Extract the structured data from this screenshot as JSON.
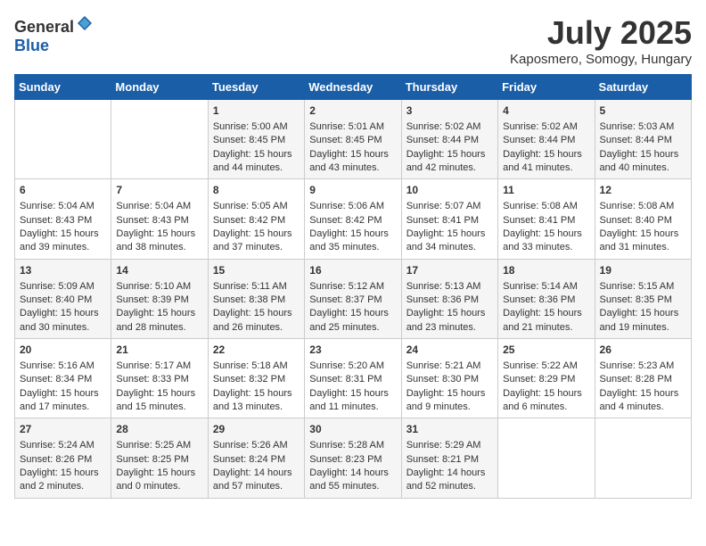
{
  "header": {
    "logo_general": "General",
    "logo_blue": "Blue",
    "month_title": "July 2025",
    "subtitle": "Kaposmero, Somogy, Hungary"
  },
  "weekdays": [
    "Sunday",
    "Monday",
    "Tuesday",
    "Wednesday",
    "Thursday",
    "Friday",
    "Saturday"
  ],
  "weeks": [
    [
      {
        "day": "",
        "sunrise": "",
        "sunset": "",
        "daylight": ""
      },
      {
        "day": "",
        "sunrise": "",
        "sunset": "",
        "daylight": ""
      },
      {
        "day": "1",
        "sunrise": "Sunrise: 5:00 AM",
        "sunset": "Sunset: 8:45 PM",
        "daylight": "Daylight: 15 hours and 44 minutes."
      },
      {
        "day": "2",
        "sunrise": "Sunrise: 5:01 AM",
        "sunset": "Sunset: 8:45 PM",
        "daylight": "Daylight: 15 hours and 43 minutes."
      },
      {
        "day": "3",
        "sunrise": "Sunrise: 5:02 AM",
        "sunset": "Sunset: 8:44 PM",
        "daylight": "Daylight: 15 hours and 42 minutes."
      },
      {
        "day": "4",
        "sunrise": "Sunrise: 5:02 AM",
        "sunset": "Sunset: 8:44 PM",
        "daylight": "Daylight: 15 hours and 41 minutes."
      },
      {
        "day": "5",
        "sunrise": "Sunrise: 5:03 AM",
        "sunset": "Sunset: 8:44 PM",
        "daylight": "Daylight: 15 hours and 40 minutes."
      }
    ],
    [
      {
        "day": "6",
        "sunrise": "Sunrise: 5:04 AM",
        "sunset": "Sunset: 8:43 PM",
        "daylight": "Daylight: 15 hours and 39 minutes."
      },
      {
        "day": "7",
        "sunrise": "Sunrise: 5:04 AM",
        "sunset": "Sunset: 8:43 PM",
        "daylight": "Daylight: 15 hours and 38 minutes."
      },
      {
        "day": "8",
        "sunrise": "Sunrise: 5:05 AM",
        "sunset": "Sunset: 8:42 PM",
        "daylight": "Daylight: 15 hours and 37 minutes."
      },
      {
        "day": "9",
        "sunrise": "Sunrise: 5:06 AM",
        "sunset": "Sunset: 8:42 PM",
        "daylight": "Daylight: 15 hours and 35 minutes."
      },
      {
        "day": "10",
        "sunrise": "Sunrise: 5:07 AM",
        "sunset": "Sunset: 8:41 PM",
        "daylight": "Daylight: 15 hours and 34 minutes."
      },
      {
        "day": "11",
        "sunrise": "Sunrise: 5:08 AM",
        "sunset": "Sunset: 8:41 PM",
        "daylight": "Daylight: 15 hours and 33 minutes."
      },
      {
        "day": "12",
        "sunrise": "Sunrise: 5:08 AM",
        "sunset": "Sunset: 8:40 PM",
        "daylight": "Daylight: 15 hours and 31 minutes."
      }
    ],
    [
      {
        "day": "13",
        "sunrise": "Sunrise: 5:09 AM",
        "sunset": "Sunset: 8:40 PM",
        "daylight": "Daylight: 15 hours and 30 minutes."
      },
      {
        "day": "14",
        "sunrise": "Sunrise: 5:10 AM",
        "sunset": "Sunset: 8:39 PM",
        "daylight": "Daylight: 15 hours and 28 minutes."
      },
      {
        "day": "15",
        "sunrise": "Sunrise: 5:11 AM",
        "sunset": "Sunset: 8:38 PM",
        "daylight": "Daylight: 15 hours and 26 minutes."
      },
      {
        "day": "16",
        "sunrise": "Sunrise: 5:12 AM",
        "sunset": "Sunset: 8:37 PM",
        "daylight": "Daylight: 15 hours and 25 minutes."
      },
      {
        "day": "17",
        "sunrise": "Sunrise: 5:13 AM",
        "sunset": "Sunset: 8:36 PM",
        "daylight": "Daylight: 15 hours and 23 minutes."
      },
      {
        "day": "18",
        "sunrise": "Sunrise: 5:14 AM",
        "sunset": "Sunset: 8:36 PM",
        "daylight": "Daylight: 15 hours and 21 minutes."
      },
      {
        "day": "19",
        "sunrise": "Sunrise: 5:15 AM",
        "sunset": "Sunset: 8:35 PM",
        "daylight": "Daylight: 15 hours and 19 minutes."
      }
    ],
    [
      {
        "day": "20",
        "sunrise": "Sunrise: 5:16 AM",
        "sunset": "Sunset: 8:34 PM",
        "daylight": "Daylight: 15 hours and 17 minutes."
      },
      {
        "day": "21",
        "sunrise": "Sunrise: 5:17 AM",
        "sunset": "Sunset: 8:33 PM",
        "daylight": "Daylight: 15 hours and 15 minutes."
      },
      {
        "day": "22",
        "sunrise": "Sunrise: 5:18 AM",
        "sunset": "Sunset: 8:32 PM",
        "daylight": "Daylight: 15 hours and 13 minutes."
      },
      {
        "day": "23",
        "sunrise": "Sunrise: 5:20 AM",
        "sunset": "Sunset: 8:31 PM",
        "daylight": "Daylight: 15 hours and 11 minutes."
      },
      {
        "day": "24",
        "sunrise": "Sunrise: 5:21 AM",
        "sunset": "Sunset: 8:30 PM",
        "daylight": "Daylight: 15 hours and 9 minutes."
      },
      {
        "day": "25",
        "sunrise": "Sunrise: 5:22 AM",
        "sunset": "Sunset: 8:29 PM",
        "daylight": "Daylight: 15 hours and 6 minutes."
      },
      {
        "day": "26",
        "sunrise": "Sunrise: 5:23 AM",
        "sunset": "Sunset: 8:28 PM",
        "daylight": "Daylight: 15 hours and 4 minutes."
      }
    ],
    [
      {
        "day": "27",
        "sunrise": "Sunrise: 5:24 AM",
        "sunset": "Sunset: 8:26 PM",
        "daylight": "Daylight: 15 hours and 2 minutes."
      },
      {
        "day": "28",
        "sunrise": "Sunrise: 5:25 AM",
        "sunset": "Sunset: 8:25 PM",
        "daylight": "Daylight: 15 hours and 0 minutes."
      },
      {
        "day": "29",
        "sunrise": "Sunrise: 5:26 AM",
        "sunset": "Sunset: 8:24 PM",
        "daylight": "Daylight: 14 hours and 57 minutes."
      },
      {
        "day": "30",
        "sunrise": "Sunrise: 5:28 AM",
        "sunset": "Sunset: 8:23 PM",
        "daylight": "Daylight: 14 hours and 55 minutes."
      },
      {
        "day": "31",
        "sunrise": "Sunrise: 5:29 AM",
        "sunset": "Sunset: 8:21 PM",
        "daylight": "Daylight: 14 hours and 52 minutes."
      },
      {
        "day": "",
        "sunrise": "",
        "sunset": "",
        "daylight": ""
      },
      {
        "day": "",
        "sunrise": "",
        "sunset": "",
        "daylight": ""
      }
    ]
  ]
}
